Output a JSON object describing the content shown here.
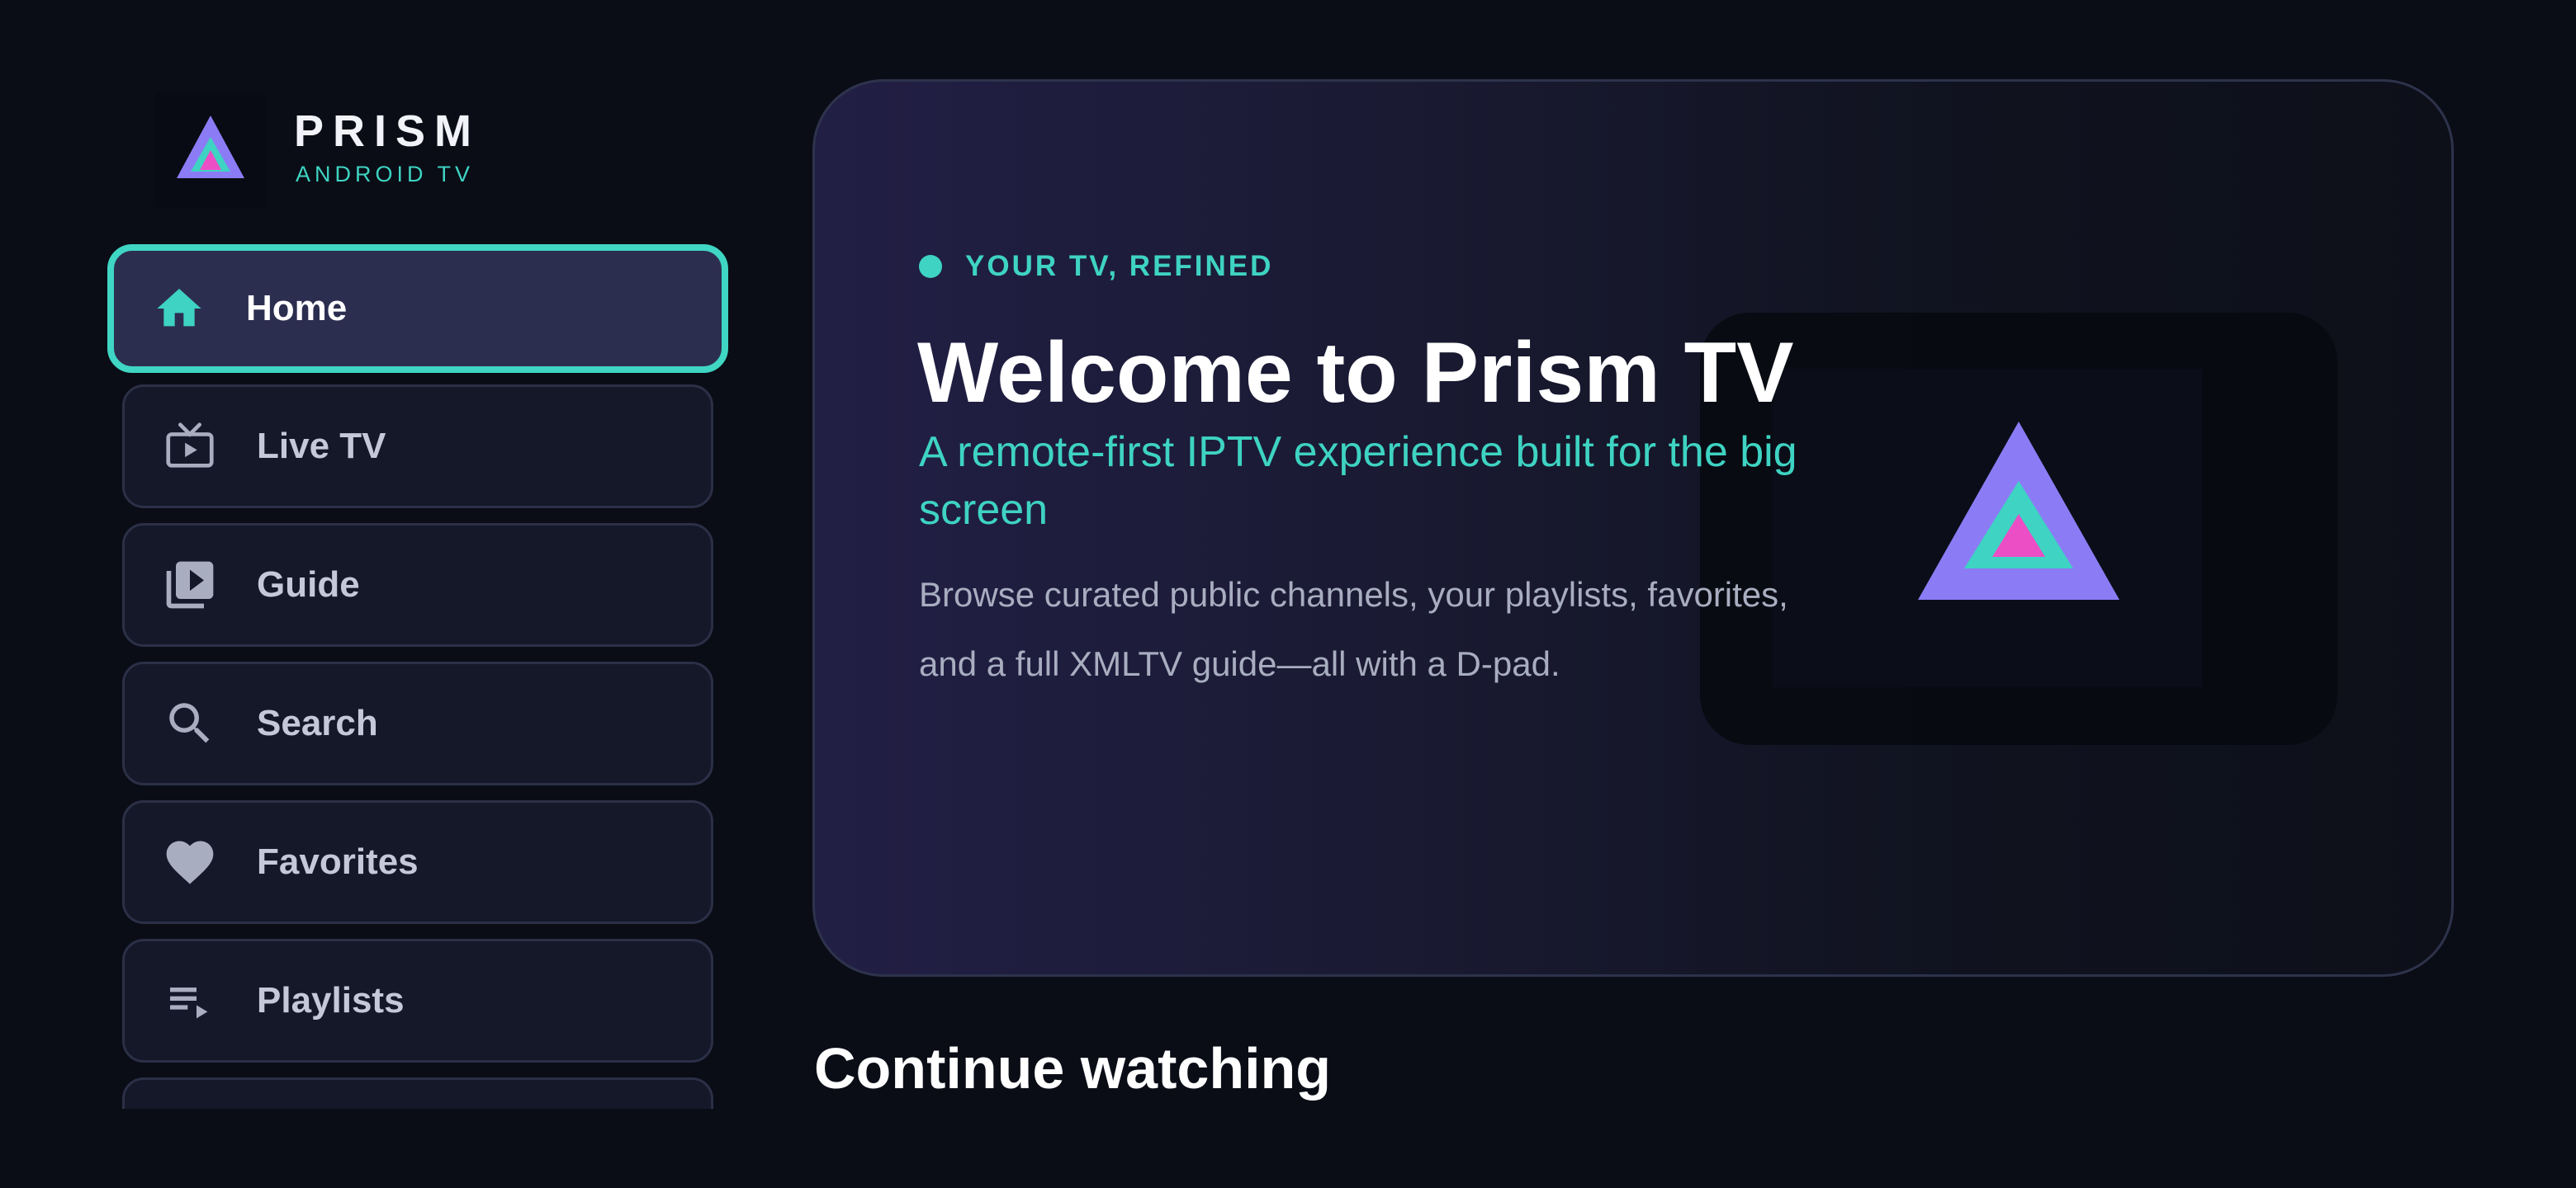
{
  "brand": {
    "name": "PRISM",
    "subtitle": "ANDROID TV",
    "logo_icon": "prism-triangle-icon",
    "colors": {
      "outer": "#8b7cf6",
      "middle": "#3ed3c2",
      "inner": "#ec4ec6"
    }
  },
  "sidebar": {
    "items": [
      {
        "label": "Home",
        "icon": "home-icon",
        "active": true
      },
      {
        "label": "Live TV",
        "icon": "tv-icon"
      },
      {
        "label": "Guide",
        "icon": "guide-icon"
      },
      {
        "label": "Search",
        "icon": "search-icon"
      },
      {
        "label": "Favorites",
        "icon": "heart-icon"
      },
      {
        "label": "Playlists",
        "icon": "playlist-icon"
      }
    ]
  },
  "hero": {
    "tagline": "YOUR TV, REFINED",
    "title": "Welcome to Prism TV",
    "subtitle": "A remote-first IPTV experience built for the big screen",
    "description": "Browse curated public channels, your playlists, favorites, and a full XMLTV guide—all with a D-pad."
  },
  "sections": {
    "continue_watching": "Continue watching"
  },
  "theme": {
    "accent": "#3ed3c2",
    "background": "#0a0d16",
    "card": "#141829"
  }
}
